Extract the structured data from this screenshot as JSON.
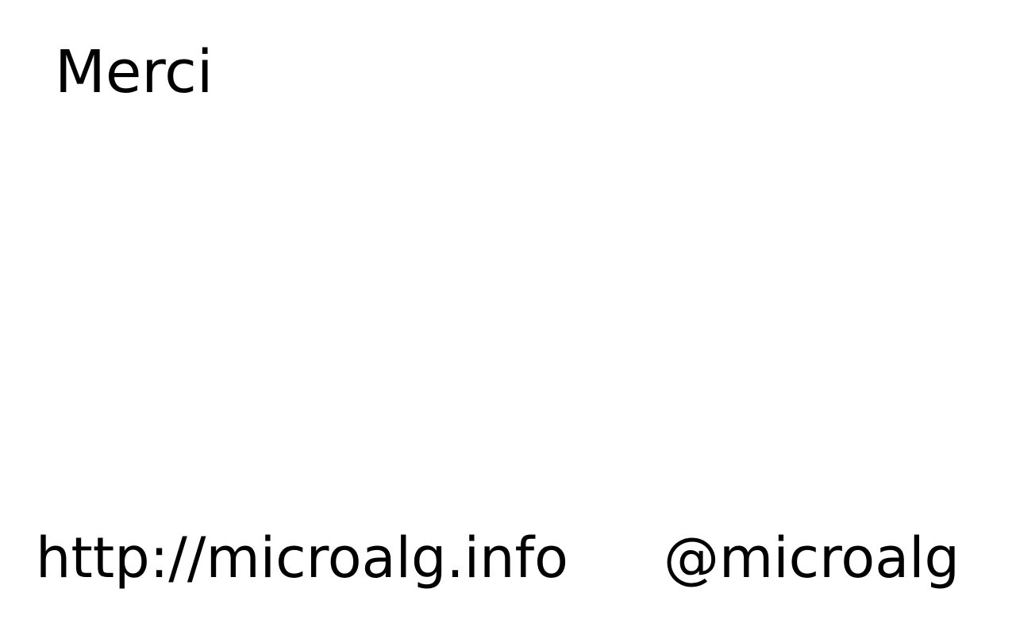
{
  "slide": {
    "title": "Merci",
    "website": "http://microalg.info",
    "handle": "@microalg"
  },
  "colors": {
    "background": "#ffffff",
    "text": "#000000"
  }
}
